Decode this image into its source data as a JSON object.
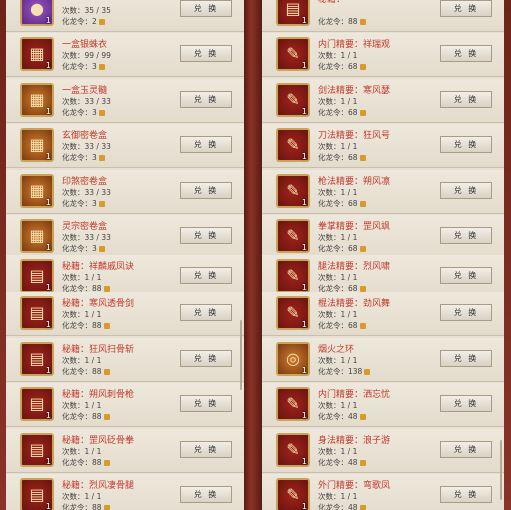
{
  "exchange_label": "兑 换",
  "left_items": [
    {
      "name": "",
      "count": "次数：35 / 35",
      "cost": "化龙令：2",
      "icon": "pearl-icon",
      "color": "purple",
      "qty": "1"
    },
    {
      "name": "一盒银蛛衣",
      "count": "次数：99 / 99",
      "cost": "化龙令：3",
      "icon": "chest-icon",
      "color": "red",
      "qty": "1"
    },
    {
      "name": "一盒玉灵髓",
      "count": "次数：33 / 33",
      "cost": "化龙令：3",
      "icon": "chest-icon",
      "color": "orange",
      "qty": "1"
    },
    {
      "name": "玄御密卷盒",
      "count": "次数：33 / 33",
      "cost": "化龙令：3",
      "icon": "chest-icon",
      "color": "orange",
      "qty": "1"
    },
    {
      "name": "印煞密卷盒",
      "count": "次数：33 / 33",
      "cost": "化龙令：3",
      "icon": "chest-icon",
      "color": "orange",
      "qty": "1"
    },
    {
      "name": "灵宗密卷盒",
      "count": "次数：33 / 33",
      "cost": "化龙令：3",
      "icon": "chest-icon",
      "color": "orange",
      "qty": "1"
    },
    {
      "name": "秘籍：祥麟戚凤诀",
      "count": "次数：1 / 1",
      "cost": "化龙令：88",
      "icon": "book-icon",
      "color": "red",
      "qty": "1"
    },
    {
      "name": "秘籍：寒风透骨剑",
      "count": "次数：1 / 1",
      "cost": "化龙令：88",
      "icon": "book-icon",
      "color": "red",
      "qty": "1"
    },
    {
      "name": "秘籍：狂风扫骨斩",
      "count": "次数：1 / 1",
      "cost": "化龙令：88",
      "icon": "book-icon",
      "color": "red",
      "qty": "1"
    },
    {
      "name": "秘籍：朔风刺骨枪",
      "count": "次数：1 / 1",
      "cost": "化龙令：88",
      "icon": "book-icon",
      "color": "red",
      "qty": "1"
    },
    {
      "name": "秘籍：罡风砭骨拳",
      "count": "次数：1 / 1",
      "cost": "化龙令：88",
      "icon": "book-icon",
      "color": "red",
      "qty": "1"
    },
    {
      "name": "秘籍：烈风凄骨腿",
      "count": "次数：1 / 1",
      "cost": "化龙令：88",
      "icon": "book-icon",
      "color": "red",
      "qty": "1"
    }
  ],
  "right_items": [
    {
      "name": "秘籍：",
      "count": "",
      "cost": "化龙令：88",
      "icon": "book-icon",
      "color": "red",
      "qty": "1"
    },
    {
      "name": "内门精要：祥瑞观",
      "count": "次数：1 / 1",
      "cost": "化龙令：68",
      "icon": "scroll-icon",
      "color": "red",
      "qty": "1"
    },
    {
      "name": "剑法精要：寒风瑟",
      "count": "次数：1 / 1",
      "cost": "化龙令：68",
      "icon": "scroll-icon",
      "color": "red",
      "qty": "1"
    },
    {
      "name": "刀法精要：狂风号",
      "count": "次数：1 / 1",
      "cost": "化龙令：68",
      "icon": "scroll-icon",
      "color": "red",
      "qty": "1"
    },
    {
      "name": "枪法精要：朔风凛",
      "count": "次数：1 / 1",
      "cost": "化龙令：68",
      "icon": "scroll-icon",
      "color": "red",
      "qty": "1"
    },
    {
      "name": "拳掌精要：罡风飒",
      "count": "次数：1 / 1",
      "cost": "化龙令：68",
      "icon": "scroll-icon",
      "color": "red",
      "qty": "1"
    },
    {
      "name": "腿法精要：烈风啸",
      "count": "次数：1 / 1",
      "cost": "化龙令：68",
      "icon": "scroll-icon",
      "color": "red",
      "qty": "1"
    },
    {
      "name": "棍法精要：劲风舞",
      "count": "次数：1 / 1",
      "cost": "化龙令：68",
      "icon": "scroll-icon",
      "color": "red",
      "qty": "1"
    },
    {
      "name": "烟火之环",
      "count": "次数：1 / 1",
      "cost": "化龙令：138",
      "icon": "ring-icon",
      "color": "orange",
      "qty": "1"
    },
    {
      "name": "内门精要：洒忘忧",
      "count": "次数：1 / 1",
      "cost": "化龙令：48",
      "icon": "scroll-icon",
      "color": "red",
      "qty": "1"
    },
    {
      "name": "身法精要：浪子游",
      "count": "次数：1 / 1",
      "cost": "化龙令：48",
      "icon": "scroll-icon",
      "color": "red",
      "qty": "1"
    },
    {
      "name": "外门精要：弯歌凤",
      "count": "次数：1 / 1",
      "cost": "化龙令：48",
      "icon": "scroll-icon",
      "color": "red",
      "qty": "1"
    }
  ]
}
